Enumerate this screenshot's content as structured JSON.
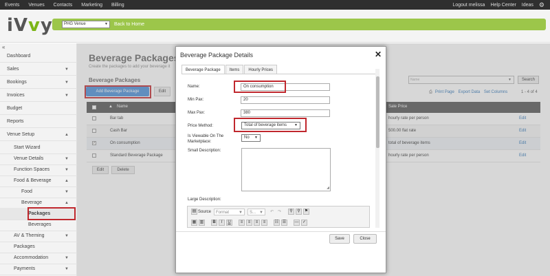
{
  "topbar": {
    "nav": [
      "Events",
      "Venues",
      "Contacts",
      "Marketing",
      "Billing"
    ],
    "right": [
      "Logout melissa",
      "Help Center",
      "Ideas"
    ]
  },
  "header": {
    "logo_main": "iV",
    "logo_y": "y",
    "logo_rest": "y",
    "venue": "PHG Venue",
    "back_home": "Back to Home"
  },
  "sidebar": {
    "items": [
      {
        "label": "Dashboard"
      },
      {
        "label": "Sales"
      },
      {
        "label": "Bookings"
      },
      {
        "label": "Invoices"
      },
      {
        "label": "Budget"
      },
      {
        "label": "Reports"
      },
      {
        "label": "Venue Setup"
      },
      {
        "label": "Start Wizard"
      },
      {
        "label": "Venue Details"
      },
      {
        "label": "Function Spaces"
      },
      {
        "label": "Food & Beverage"
      },
      {
        "label": "Food"
      },
      {
        "label": "Beverage"
      },
      {
        "label": "Packages"
      },
      {
        "label": "Beverages"
      },
      {
        "label": "AV & Theming"
      },
      {
        "label": "Packages"
      },
      {
        "label": "Accommodation"
      },
      {
        "label": "Payments"
      }
    ]
  },
  "page": {
    "title": "Beverage Packages",
    "subtitle": "Create the packages to add your beverage it",
    "section": "Beverage Packages",
    "add_button": "Add Beverage Package",
    "edit_button": "Edit",
    "search_placeholder": "Name",
    "search_button": "Search",
    "toolbar": [
      "Print Page",
      "Export Data",
      "Set Columns"
    ],
    "count": "1 - 4 of 4",
    "columns": {
      "name": "Name",
      "sale_price": "Sale Price"
    },
    "rows": [
      {
        "name": "Bar tab",
        "price": "hourly rate per person",
        "edit": "Edit"
      },
      {
        "name": "Cash Bar",
        "price": "500.00 flat rate",
        "edit": "Edit"
      },
      {
        "name": "On consumption",
        "price": "total of beverage items",
        "edit": "Edit"
      },
      {
        "name": "Standard Beverage Package",
        "price": "hourly rate per person",
        "edit": "Edit"
      }
    ],
    "bottom_edit": "Edit",
    "bottom_delete": "Delete"
  },
  "modal": {
    "title": "Beverage Package Details",
    "close": "✕",
    "tabs": [
      "Beverage Package",
      "Items",
      "Hourly Prices"
    ],
    "name_label": "Name:",
    "name_value": "On consumption",
    "min_pax_label": "Min Pax:",
    "min_pax_value": "20",
    "max_pax_label": "Max Pax:",
    "max_pax_value": "380",
    "price_method_label": "Price Method:",
    "price_method_value": "Total of beverage items",
    "viewable_label_1": "Is Viewable On The",
    "viewable_label_2": "Marketplace:",
    "viewable_value": "No",
    "small_desc_label": "Small Description:",
    "large_desc_label": "Large Description:",
    "editor": {
      "source": "Source",
      "format": "Format",
      "size": "S..."
    },
    "save": "Save",
    "close_button": "Close"
  }
}
